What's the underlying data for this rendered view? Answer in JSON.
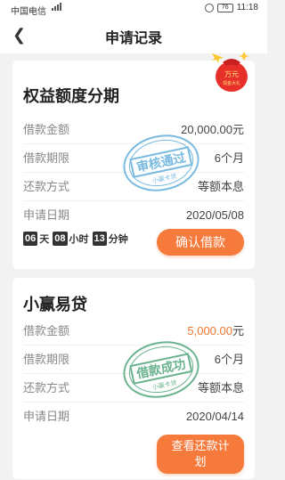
{
  "status_bar": {
    "carrier": "中国电信",
    "battery": "76",
    "time": "11:18"
  },
  "nav": {
    "title": "申请记录"
  },
  "promo": {
    "line1": "万元",
    "line2": "现金大礼"
  },
  "card1": {
    "title": "权益额度分期",
    "rows": [
      {
        "label": "借款金额",
        "value": "20,000.00元"
      },
      {
        "label": "借款期限",
        "value": "6个月"
      },
      {
        "label": "还款方式",
        "value": "等额本息"
      },
      {
        "label": "申请日期",
        "value": "2020/05/08"
      }
    ],
    "countdown": {
      "days": "06",
      "days_unit": "天",
      "hours": "08",
      "hours_unit": "小时",
      "minutes": "13",
      "minutes_unit": "分钟"
    },
    "button": "确认借款",
    "stamp": {
      "text": "审核通过",
      "sub": "小赢卡贷",
      "color": "#4ba3d6"
    }
  },
  "card2": {
    "title": "小赢易贷",
    "rows": [
      {
        "label": "借款金额",
        "value": "5,000.00",
        "unit": "元"
      },
      {
        "label": "借款期限",
        "value": "6个月"
      },
      {
        "label": "还款方式",
        "value": "等额本息"
      },
      {
        "label": "申请日期",
        "value": "2020/04/14"
      }
    ],
    "button_line1": "查看还款计",
    "button_line2": "划",
    "stamp": {
      "text": "借款成功",
      "sub": "小赢卡贷",
      "color": "#3a9a6a"
    }
  }
}
